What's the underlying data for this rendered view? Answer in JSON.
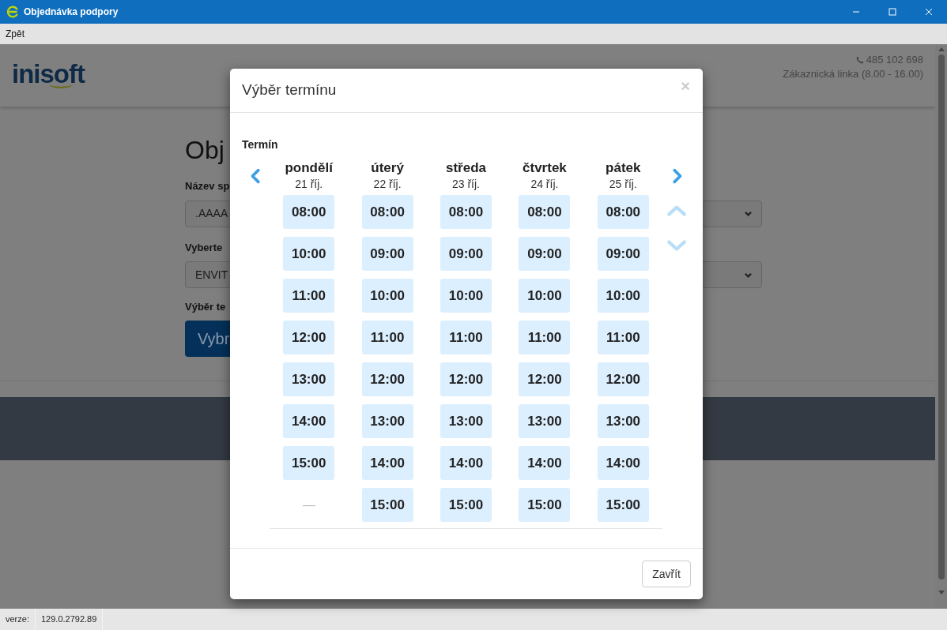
{
  "window": {
    "title": "Objednávka podpory"
  },
  "menu": [
    "Zpět"
  ],
  "header": {
    "logo": "inisoft",
    "phone": "485 102 698",
    "hotline": "Zákaznická linka (8.00 - 16.00)"
  },
  "form": {
    "heading": "Obj",
    "fields": [
      {
        "label": "Název sp",
        "value": ".AAAA"
      },
      {
        "label": "Vyberte",
        "value": "ENVIT"
      }
    ],
    "choose_label": "Výběr te",
    "choose_button": "Vybr"
  },
  "modal": {
    "title": "Výběr termínu",
    "close": "×",
    "section_label": "Termín",
    "days": [
      {
        "name": "pondělí",
        "date": "21 říj.",
        "slots": [
          {
            "kind": "time",
            "text": "08:00"
          },
          {
            "kind": "time",
            "text": "10:00"
          },
          {
            "kind": "time",
            "text": "11:00"
          },
          {
            "kind": "time",
            "text": "12:00"
          },
          {
            "kind": "time",
            "text": "13:00"
          },
          {
            "kind": "time",
            "text": "14:00"
          },
          {
            "kind": "time",
            "text": "15:00"
          },
          {
            "kind": "empty",
            "text": "—"
          }
        ]
      },
      {
        "name": "úterý",
        "date": "22 říj.",
        "slots": [
          {
            "kind": "time",
            "text": "08:00"
          },
          {
            "kind": "time",
            "text": "09:00"
          },
          {
            "kind": "time",
            "text": "10:00"
          },
          {
            "kind": "time",
            "text": "11:00"
          },
          {
            "kind": "time",
            "text": "12:00"
          },
          {
            "kind": "time",
            "text": "13:00"
          },
          {
            "kind": "time",
            "text": "14:00"
          },
          {
            "kind": "time",
            "text": "15:00"
          }
        ]
      },
      {
        "name": "středa",
        "date": "23 říj.",
        "slots": [
          {
            "kind": "time",
            "text": "08:00"
          },
          {
            "kind": "time",
            "text": "09:00"
          },
          {
            "kind": "time",
            "text": "10:00"
          },
          {
            "kind": "time",
            "text": "11:00"
          },
          {
            "kind": "time",
            "text": "12:00"
          },
          {
            "kind": "time",
            "text": "13:00"
          },
          {
            "kind": "time",
            "text": "14:00"
          },
          {
            "kind": "time",
            "text": "15:00"
          }
        ]
      },
      {
        "name": "čtvrtek",
        "date": "24 říj.",
        "slots": [
          {
            "kind": "time",
            "text": "08:00"
          },
          {
            "kind": "time",
            "text": "09:00"
          },
          {
            "kind": "time",
            "text": "10:00"
          },
          {
            "kind": "time",
            "text": "11:00"
          },
          {
            "kind": "time",
            "text": "12:00"
          },
          {
            "kind": "time",
            "text": "13:00"
          },
          {
            "kind": "time",
            "text": "14:00"
          },
          {
            "kind": "time",
            "text": "15:00"
          }
        ]
      },
      {
        "name": "pátek",
        "date": "25 říj.",
        "slots": [
          {
            "kind": "time",
            "text": "08:00"
          },
          {
            "kind": "time",
            "text": "09:00"
          },
          {
            "kind": "time",
            "text": "10:00"
          },
          {
            "kind": "time",
            "text": "11:00"
          },
          {
            "kind": "time",
            "text": "12:00"
          },
          {
            "kind": "time",
            "text": "13:00"
          },
          {
            "kind": "time",
            "text": "14:00"
          },
          {
            "kind": "time",
            "text": "15:00"
          }
        ]
      }
    ],
    "footer_button": "Zavřít"
  },
  "status_bar": {
    "label": "verze:",
    "value": "129.0.2792.89"
  }
}
